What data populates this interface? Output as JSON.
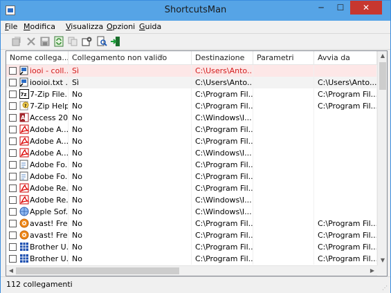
{
  "window": {
    "title": "ShortcutsMan"
  },
  "titlebar_buttons": {
    "minimize": "─",
    "maximize": "☐",
    "close": "✕"
  },
  "menu": {
    "items": [
      "File",
      "Modifica",
      "Visualizza",
      "Opzioni",
      "Guida"
    ]
  },
  "toolbar": {
    "icons": [
      "properties-icon",
      "delete-icon",
      "save-icon",
      "refresh-icon",
      "copy-icon",
      "options-icon",
      "find-icon",
      "exit-icon"
    ]
  },
  "table": {
    "columns": [
      "Nome collega...",
      "Collegamento non valido",
      "Destinazione",
      "Parametri",
      "Avvia da"
    ],
    "rows": [
      {
        "name": "iooi - coll...",
        "icon": "shortcut-icon",
        "invalid": "Sì",
        "dest": "C:\\Users\\Anto...",
        "params": "",
        "start": "",
        "state": "selected"
      },
      {
        "name": "iooioi.txt ...",
        "icon": "shortcut-icon",
        "invalid": "Sì",
        "dest": "C:\\Users\\Anto...",
        "params": "",
        "start": "C:\\Users\\Anto...",
        "state": "hover"
      },
      {
        "name": "7-Zip File...",
        "icon": "7zip-icon",
        "invalid": "No",
        "dest": "C:\\Program Fil...",
        "params": "",
        "start": "C:\\Program Fil...",
        "state": ""
      },
      {
        "name": "7-Zip Help",
        "icon": "help-icon",
        "invalid": "No",
        "dest": "C:\\Program Fil...",
        "params": "",
        "start": "C:\\Program Fil...",
        "state": ""
      },
      {
        "name": "Access 20...",
        "icon": "access-icon",
        "invalid": "No",
        "dest": "C:\\Windows\\I...",
        "params": "",
        "start": "",
        "state": ""
      },
      {
        "name": "Adobe A...",
        "icon": "pdf-icon",
        "invalid": "No",
        "dest": "C:\\Program Fil...",
        "params": "",
        "start": "",
        "state": ""
      },
      {
        "name": "Adobe A...",
        "icon": "pdf-icon",
        "invalid": "No",
        "dest": "C:\\Program Fil...",
        "params": "",
        "start": "",
        "state": ""
      },
      {
        "name": "Adobe A...",
        "icon": "pdf-icon",
        "invalid": "No",
        "dest": "C:\\Windows\\I...",
        "params": "",
        "start": "",
        "state": ""
      },
      {
        "name": "Adobe Fo...",
        "icon": "form-icon",
        "invalid": "No",
        "dest": "C:\\Program Fil...",
        "params": "",
        "start": "",
        "state": ""
      },
      {
        "name": "Adobe Fo...",
        "icon": "form-icon",
        "invalid": "No",
        "dest": "C:\\Program Fil...",
        "params": "",
        "start": "",
        "state": ""
      },
      {
        "name": "Adobe Re...",
        "icon": "pdf-icon",
        "invalid": "No",
        "dest": "C:\\Program Fil...",
        "params": "",
        "start": "",
        "state": ""
      },
      {
        "name": "Adobe Re...",
        "icon": "pdf-icon",
        "invalid": "No",
        "dest": "C:\\Windows\\I...",
        "params": "",
        "start": "",
        "state": ""
      },
      {
        "name": "Apple Sof...",
        "icon": "globe-icon",
        "invalid": "No",
        "dest": "C:\\Windows\\I...",
        "params": "",
        "start": "",
        "state": ""
      },
      {
        "name": "avast! Fre...",
        "icon": "avast-icon",
        "invalid": "No",
        "dest": "C:\\Program Fil...",
        "params": "",
        "start": "C:\\Program Fil...",
        "state": ""
      },
      {
        "name": "avast! Fre...",
        "icon": "avast-icon",
        "invalid": "No",
        "dest": "C:\\Program Fil...",
        "params": "",
        "start": "C:\\Program Fil...",
        "state": ""
      },
      {
        "name": "Brother U...",
        "icon": "brother-icon",
        "invalid": "No",
        "dest": "C:\\Program Fil...",
        "params": "",
        "start": "C:\\Program Fil...",
        "state": ""
      },
      {
        "name": "Brother U...",
        "icon": "brother-icon",
        "invalid": "No",
        "dest": "C:\\Program Fil...",
        "params": "",
        "start": "C:\\Program Fil...",
        "state": ""
      }
    ]
  },
  "status": {
    "text": "112 collegamenti"
  }
}
